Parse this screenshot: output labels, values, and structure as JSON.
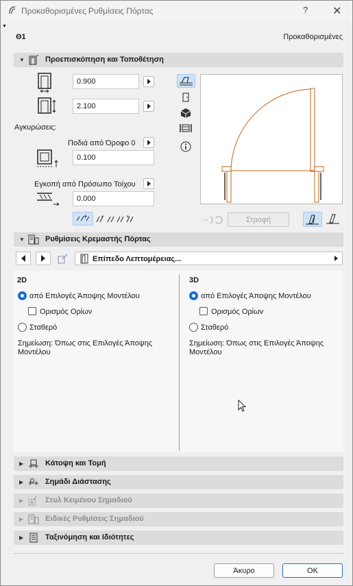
{
  "window": {
    "title": "Προκαθορισμένες Ρυθμίσεις Πόρτας",
    "help_label": "?",
    "close_label": "✕"
  },
  "header": {
    "element_id": "Θ1",
    "preset": "Προκαθορισμένες"
  },
  "preview_section": {
    "label": "Προεπισκόπηση και Τοποθέτηση",
    "width_value": "0.900",
    "height_value": "2.100",
    "anchors_label": "Αγκυρώσεις:",
    "sill_ref_label": "Ποδιά από Όροφο 0",
    "sill_value": "0.100",
    "reveal_ref_label": "Εγκοπή από Πρόσωπο Τοίχου",
    "reveal_value": "0.000",
    "rotate_label": "Στροφή"
  },
  "hanging_section": {
    "label": "Ρυθμίσεις Κρεμαστής Πόρτας",
    "level_label": "Επίπεδο Λεπτομέρειας...",
    "col_2d": {
      "title": "2D",
      "option_model": "από Επιλογές Άποψης Μοντέλου",
      "option_bounds": "Ορισμός Ορίων",
      "option_fixed": "Σταθερό",
      "note": "Σημείωση: Όπως στις Επιλογές Άποψης Μοντέλου"
    },
    "col_3d": {
      "title": "3D",
      "option_model": "από Επιλογές Άποψης Μοντέλου",
      "option_bounds": "Ορισμός Ορίων",
      "option_fixed": "Σταθερό",
      "note": "Σημείωση: Όπως στις Επιλογές Άποψης Μοντέλου"
    }
  },
  "collapsed_sections": [
    {
      "label": "Κάτοψη και Τομή"
    },
    {
      "label": "Σημάδι Διάστασης"
    },
    {
      "label": "Στυλ Κειμένου Σημαδιού"
    },
    {
      "label": "Ειδικές Ρυθμίσεις Σημαδιού"
    },
    {
      "label": "Ταξινόμηση και Ιδιότητες"
    }
  ],
  "footer": {
    "cancel_label": "Άκυρο",
    "ok_label": "OK"
  },
  "colors": {
    "accent": "#1a6fd0",
    "door_line": "#c0651a",
    "section_bar": "#dcdcdc"
  }
}
